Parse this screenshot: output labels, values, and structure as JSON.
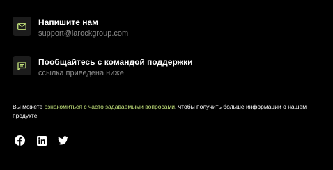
{
  "contacts": [
    {
      "icon": "mail-icon",
      "title": "Напишите нам",
      "subtitle": "support@larockgroup.com"
    },
    {
      "icon": "chat-icon",
      "title": "Пообщайтесь с командой поддержки",
      "subtitle": "ссылка приведена ниже"
    }
  ],
  "faq": {
    "before": "Вы можете ",
    "link": "ознакомиться с часто задаваемыми вопросами",
    "after": ", чтобы получить больше информации о нашем продукте."
  },
  "socials": [
    "facebook-icon",
    "linkedin-icon",
    "twitter-icon"
  ],
  "colors": {
    "background": "#000000",
    "accent": "#c6e67d",
    "icon_box": "#1c1c1c",
    "muted_text": "#8a8a8a"
  }
}
